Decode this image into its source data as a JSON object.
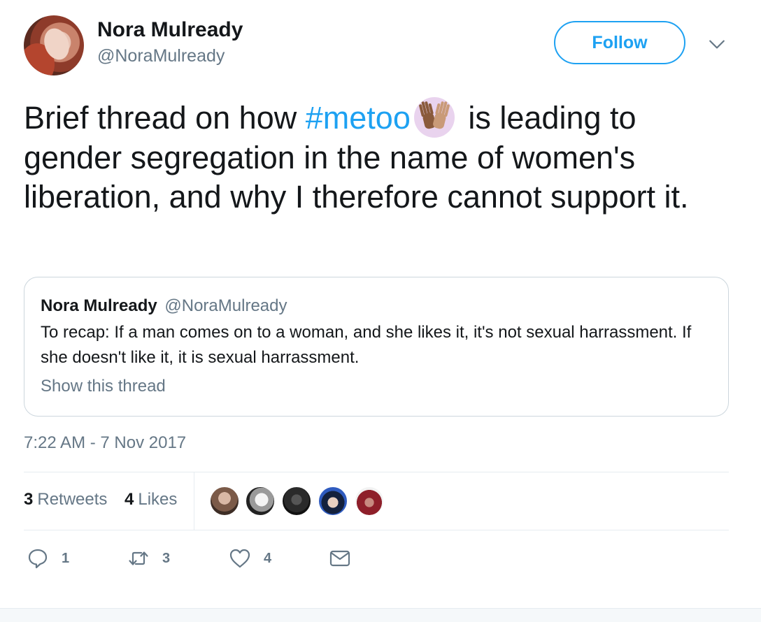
{
  "author": {
    "name": "Nora Mulready",
    "handle": "@NoraMulready"
  },
  "follow_label": "Follow",
  "tweet": {
    "text_before": "Brief thread on how ",
    "hashtag": "#metoo",
    "text_after": " is leading to gender segregation in the name of women's liberation, and why I therefore cannot support it."
  },
  "quoted_tweet": {
    "name": "Nora Mulready",
    "handle": "@NoraMulready",
    "text": "To recap: If a man comes on to a woman, and she likes it, it's not sexual harrassment. If she doesn't like it, it is sexual harrassment.",
    "show_thread": "Show this thread"
  },
  "timestamp": "7:22 AM - 7 Nov 2017",
  "stats": {
    "retweets_count": "3",
    "retweets_label": "Retweets",
    "likes_count": "4",
    "likes_label": "Likes"
  },
  "actions": {
    "reply_count": "1",
    "retweet_count": "3",
    "like_count": "4"
  },
  "colors": {
    "accent": "#1da1f2",
    "secondary_text": "#657786",
    "border": "#e6ecf0"
  },
  "icons": [
    "caret-down-icon",
    "high-five-emoji",
    "reply-icon",
    "retweet-icon",
    "heart-icon",
    "direct-message-icon"
  ]
}
